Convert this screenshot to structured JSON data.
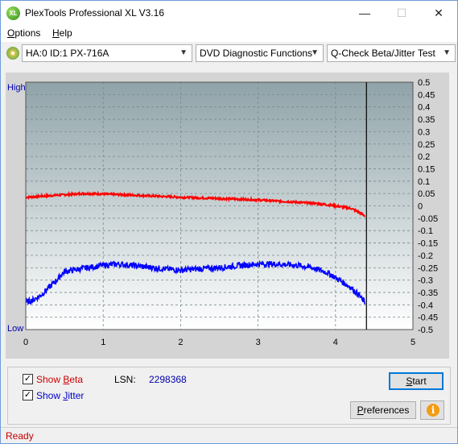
{
  "window": {
    "title": "PlexTools Professional XL V3.16",
    "icon_text": "XL",
    "minimize": "—",
    "maximize": "☐",
    "close": "✕"
  },
  "menu": {
    "items": [
      {
        "pre": "",
        "accel": "O",
        "post": "ptions"
      },
      {
        "pre": "",
        "accel": "H",
        "post": "elp"
      }
    ]
  },
  "toolbar": {
    "drive": "HA:0 ID:1  PX-716A",
    "function": "DVD Diagnostic Functions",
    "test": "Q-Check Beta/Jitter Test",
    "dropdown_icon": "chevron-down"
  },
  "chart_data": {
    "type": "line",
    "x_ticks": [
      "0",
      "1",
      "2",
      "3",
      "4",
      "5"
    ],
    "xlim": [
      0,
      5
    ],
    "left_labels": {
      "high": "High",
      "low": "Low"
    },
    "y_right_ticks": [
      "0.5",
      "0.45",
      "0.4",
      "0.35",
      "0.3",
      "0.25",
      "0.2",
      "0.15",
      "0.1",
      "0.05",
      "0",
      "-0.05",
      "-0.1",
      "-0.15",
      "-0.2",
      "-0.25",
      "-0.3",
      "-0.35",
      "-0.4",
      "-0.45",
      "-0.5"
    ],
    "ylim": [
      -0.5,
      0.5
    ],
    "grid": true,
    "end_marker_x": 4.4,
    "colors": {
      "beta": "#ff0000",
      "jitter": "#0000ff",
      "plot_top": "#8fa3a8",
      "plot_bottom": "#ffffff"
    },
    "series": [
      {
        "name": "Beta",
        "x": [
          0,
          0.25,
          0.5,
          0.75,
          1.0,
          1.5,
          2.0,
          2.5,
          3.0,
          3.5,
          3.8,
          4.0,
          4.2,
          4.3,
          4.38
        ],
        "y": [
          0.035,
          0.04,
          0.045,
          0.05,
          0.048,
          0.042,
          0.035,
          0.03,
          0.024,
          0.015,
          0.008,
          0.0,
          -0.01,
          -0.025,
          -0.04
        ]
      },
      {
        "name": "Jitter",
        "x": [
          0,
          0.1,
          0.2,
          0.3,
          0.4,
          0.5,
          0.6,
          0.8,
          1.0,
          1.2,
          1.5,
          1.8,
          2.0,
          2.2,
          2.5,
          2.8,
          3.0,
          3.2,
          3.5,
          3.7,
          3.9,
          4.0,
          4.1,
          4.2,
          4.3,
          4.38
        ],
        "y": [
          -0.39,
          -0.38,
          -0.36,
          -0.33,
          -0.3,
          -0.265,
          -0.26,
          -0.25,
          -0.24,
          -0.235,
          -0.245,
          -0.255,
          -0.26,
          -0.255,
          -0.25,
          -0.24,
          -0.235,
          -0.235,
          -0.24,
          -0.25,
          -0.27,
          -0.29,
          -0.31,
          -0.33,
          -0.36,
          -0.39
        ]
      }
    ]
  },
  "options": {
    "show_beta": {
      "checked": "✓",
      "pre": "Show ",
      "accel": "B",
      "post": "eta",
      "color": "#cc0000"
    },
    "show_jitter": {
      "checked": "✓",
      "pre": "Show ",
      "accel": "J",
      "post": "itter",
      "color": "#0000cc"
    },
    "lsn_label": "LSN:",
    "lsn_value": "2298368"
  },
  "buttons": {
    "start": {
      "pre": "",
      "accel": "S",
      "post": "tart"
    },
    "preferences": {
      "pre": "",
      "accel": "P",
      "post": "references"
    },
    "info_icon": "i"
  },
  "status": {
    "text": "Ready"
  }
}
